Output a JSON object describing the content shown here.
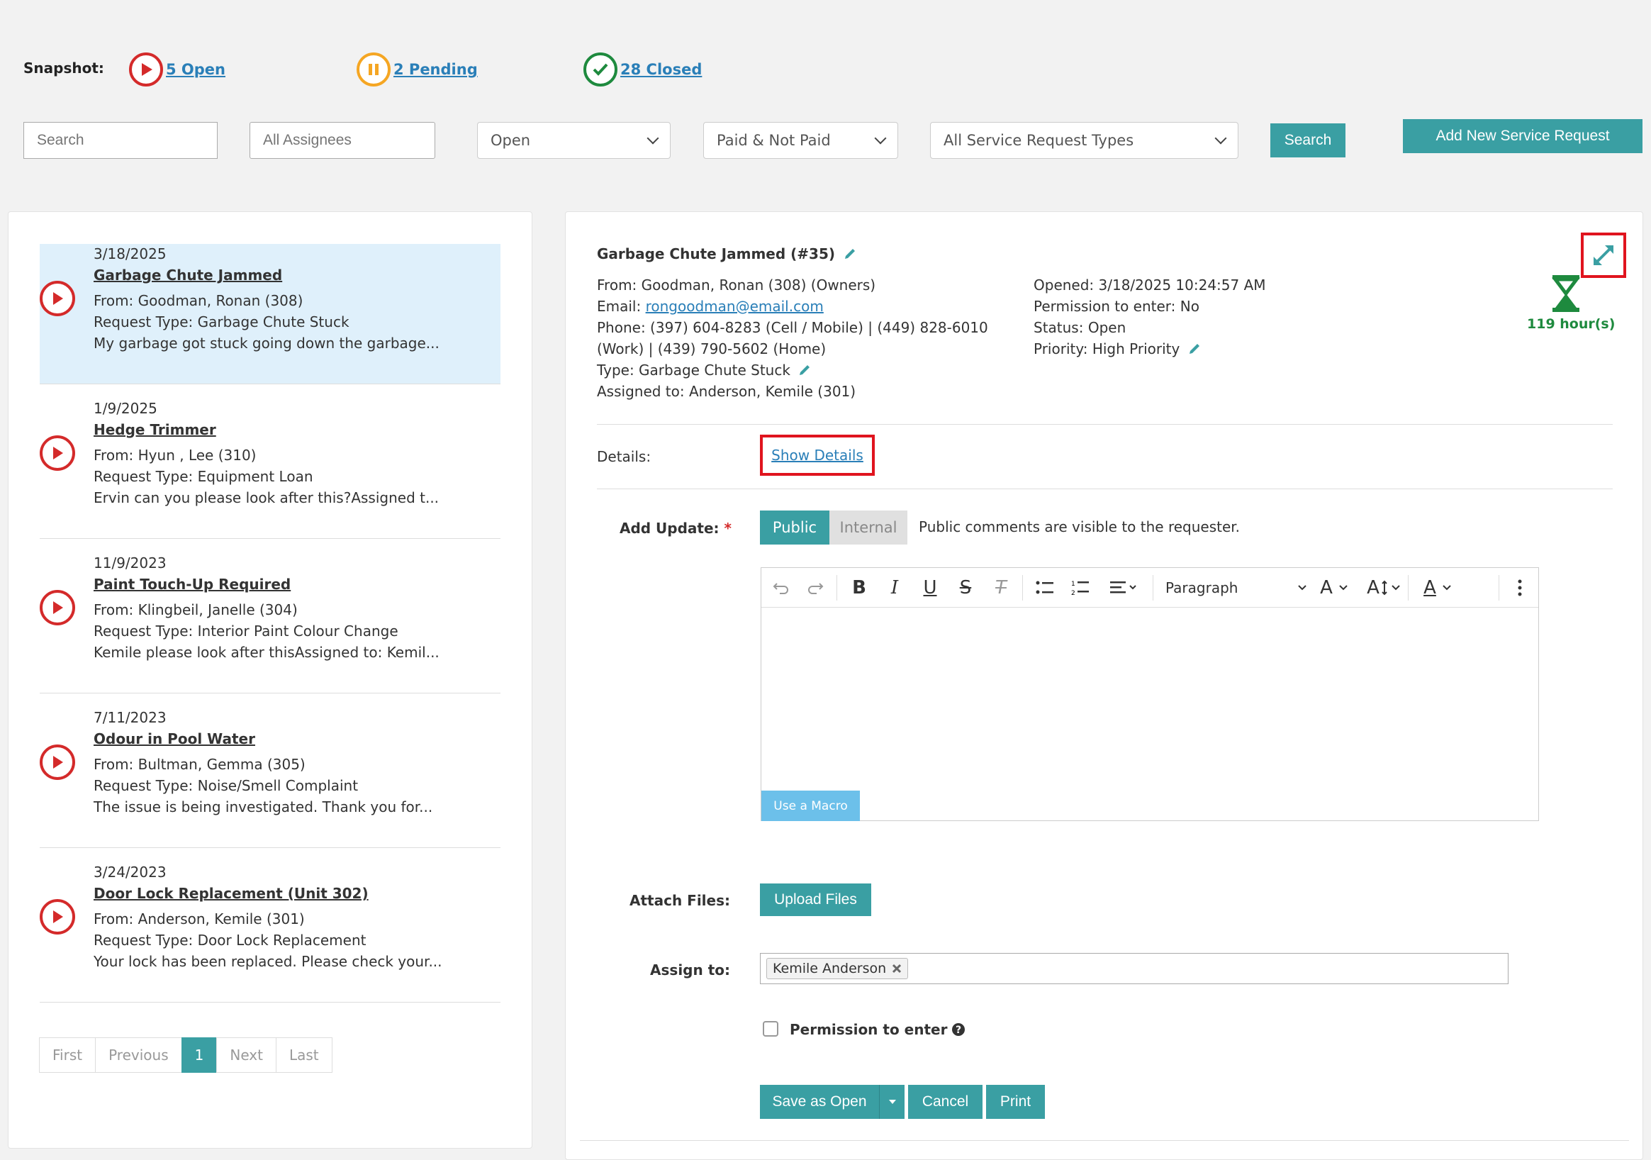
{
  "snapshot": {
    "label": "Snapshot:",
    "open_label": "5 Open",
    "pending_label": "2 Pending",
    "closed_label": "28 Closed"
  },
  "filters": {
    "search_placeholder": "Search",
    "assignees_placeholder": "All Assignees",
    "status_selected": "Open",
    "paid_selected": "Paid & Not Paid",
    "types_selected": "All Service Request Types",
    "search_button": "Search",
    "add_button": "Add New Service Request"
  },
  "list": {
    "items": [
      {
        "date": "3/18/2025",
        "title": "Garbage Chute Jammed",
        "from": "From: Goodman, Ronan (308)",
        "type": "Request Type: Garbage Chute Stuck",
        "snippet": "My garbage got stuck going down the garbage..."
      },
      {
        "date": "1/9/2025",
        "title": "Hedge Trimmer",
        "from": "From: Hyun , Lee (310)",
        "type": "Request Type: Equipment Loan",
        "snippet": "Ervin can you please look after this?Assigned t..."
      },
      {
        "date": "11/9/2023",
        "title": "Paint Touch-Up Required",
        "from": "From: Klingbeil, Janelle (304)",
        "type": "Request Type: Interior Paint Colour Change",
        "snippet": "Kemile please look after thisAssigned to: Kemil..."
      },
      {
        "date": "7/11/2023",
        "title": "Odour in Pool Water",
        "from": "From: Bultman, Gemma (305)",
        "type": "Request Type: Noise/Smell Complaint",
        "snippet": "The issue is being investigated. Thank you for..."
      },
      {
        "date": "3/24/2023",
        "title": "Door Lock Replacement (Unit 302)",
        "from": "From: Anderson, Kemile (301)",
        "type": "Request Type: Door Lock Replacement",
        "snippet": "Your lock has been replaced. Please check your..."
      }
    ],
    "pager": {
      "first": "First",
      "previous": "Previous",
      "current": "1",
      "next": "Next",
      "last": "Last"
    }
  },
  "detail": {
    "title": "Garbage Chute Jammed (#35)",
    "from": "From: Goodman, Ronan (308) (Owners)",
    "email_label": "Email: ",
    "email": "rongoodman@email.com",
    "phone1": "Phone: (397) 604-8283 (Cell / Mobile) | (449) 828-6010",
    "phone2": "(Work) | (439) 790-5602 (Home)",
    "type": "Type: Garbage Chute Stuck",
    "assigned": "Assigned to: Anderson, Kemile (301)",
    "opened": "Opened: 3/18/2025 10:24:57 AM",
    "permission": "Permission to enter: No",
    "status": "Status: Open",
    "priority": "Priority: High Priority",
    "hours": "119 hour(s)",
    "details_label": "Details:",
    "show_details": "Show Details",
    "add_update_label": "Add Update:",
    "required_mark": "*",
    "public_tab": "Public",
    "internal_tab": "Internal",
    "public_note": "Public comments are visible to the requester.",
    "editor": {
      "bold": "B",
      "italic": "I",
      "underline": "U",
      "strike": "S",
      "clear": "T",
      "paragraph": "Paragraph",
      "font_family": "A",
      "font_size": "A",
      "font_color": "A",
      "macro_button": "Use a Macro"
    },
    "attach_label": "Attach Files:",
    "upload_button": "Upload Files",
    "assign_label": "Assign to:",
    "assignee_tag": "Kemile Anderson",
    "permission_checkbox": "Permission to enter",
    "save_button": "Save as Open",
    "cancel_button": "Cancel",
    "print_button": "Print"
  },
  "colors": {
    "teal": "#3a9fa3",
    "open_red": "#d42a2a",
    "pending_orange": "#f5a623",
    "closed_green": "#1e8a3e",
    "link_blue": "#2a7fb8",
    "highlight_red": "#e0141e"
  }
}
